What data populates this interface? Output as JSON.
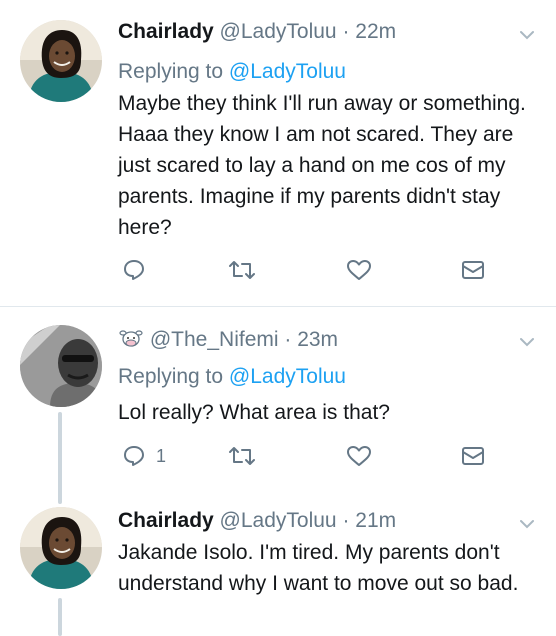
{
  "tweets": [
    {
      "name": "Chairlady",
      "handle": "@LadyToluu",
      "sep": " · ",
      "time": "22m",
      "replying_prefix": "Replying to ",
      "replying_mention": "@LadyToluu",
      "text": "Maybe they think I'll run away or something.  Haaa they know I am not scared.  They are just scared to lay a hand on me cos of my parents.  Imagine if my parents didn't stay here?",
      "reply_count": "",
      "avatar_icon": "woman-avatar"
    },
    {
      "name": "",
      "handle": "@The_Nifemi",
      "sep": " · ",
      "time": "23m",
      "replying_prefix": "Replying to ",
      "replying_mention": "@LadyToluu",
      "text": "Lol really? What area is that?",
      "reply_count": "1",
      "avatar_icon": "man-avatar",
      "name_icon": "cow-emoji-icon"
    },
    {
      "name": "Chairlady",
      "handle": "@LadyToluu",
      "sep": " · ",
      "time": "21m",
      "text": "Jakande Isolo.  I'm tired.  My parents don't understand why I want to move out so bad.",
      "avatar_icon": "woman-avatar"
    }
  ],
  "colors": {
    "link": "#1da1f2",
    "secondary": "#657786",
    "divider": "#e1e8ed",
    "thread": "#ccd6dd"
  }
}
